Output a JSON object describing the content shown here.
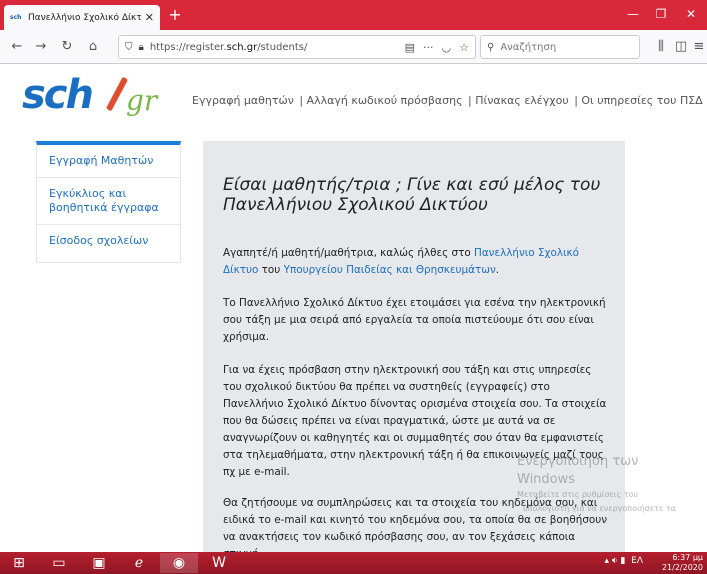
{
  "browser": {
    "tab_title": "Πανελλήνιο Σχολικό Δίκτυο - Ε",
    "favicon_text": "sch",
    "url_prefix": "https://register.",
    "url_domain": "sch.gr",
    "url_path": "/students/",
    "search_placeholder": "Αναζήτηση"
  },
  "site": {
    "logo_main": "sch",
    "logo_tld": "gr",
    "nav": [
      "Εγγραφή μαθητών",
      "| Αλλαγή κωδικού πρόσβασης",
      "| Πίνακας ελέγχου",
      "| Οι υπηρεσίες του ΠΣΔ"
    ]
  },
  "sidebar": {
    "items": [
      {
        "label": "Εγγραφή Μαθητών"
      },
      {
        "label": "Εγκύκλιος και βοηθητικά έγγραφα"
      },
      {
        "label": "Είσοδος σχολείων"
      }
    ]
  },
  "content": {
    "heading": "Είσαι μαθητής/τρια ; Γίνε και εσύ μέλος του Πανελλήνιου Σχολικού Δικτύου",
    "p1_a": "Αγαπητέ/ή μαθητή/μαθήτρια, καλώς ήλθες στο ",
    "p1_link1": "Πανελλήνιο Σχολικό Δίκτυο",
    "p1_b": " του ",
    "p1_link2": "Υπουργείου Παιδείας και Θρησκευμάτων",
    "p1_c": ".",
    "p2": "Το Πανελλήνιο Σχολικό Δίκτυο έχει ετοιμάσει για εσένα την ηλεκτρονική σου τάξη με μια σειρά από εργαλεία τα οποία πιστεύουμε ότι σου είναι χρήσιμα.",
    "p3": "Για να έχεις πρόσβαση στην ηλεκτρονική σου τάξη και στις υπηρεσίες του σχολικού δικτύου θα πρέπει να συστηθείς (εγγραφείς) στο Πανελλήνιο Σχολικό Δίκτυο δίνοντας ορισμένα στοιχεία σου. Τα στοιχεία που θα δώσεις πρέπει να είναι πραγματικά, ώστε με αυτά να σε αναγνωρίζουν οι καθηγητές και οι συμμαθητές σου όταν θα εμφανιστείς στα τηλεμαθήματα, στην ηλεκτρονική τάξη ή θα επικοινωνείς μαζί τους πχ με e-mail.",
    "p4": "Θα ζητήσουμε να συμπληρώσεις και τα στοιχεία του κηδεμόνα σου, και ειδικά το e-mail και κινητό του κηδεμόνα σου, τα οποία θα σε βοηθήσουν να ανακτήσεις τον κωδικό πρόσβασης σου, αν τον ξεχάσεις κάποια στιγμή."
  },
  "watermark": {
    "line1": "Ενεργοποίηση των",
    "line2": "Windows",
    "line3": "Μεταβείτε στις ρυθμίσεις του",
    "line4": "υπολογιστή για να ενεργοποιήσετε τα"
  },
  "taskbar": {
    "lang": "ΕΛ",
    "time": "6:37 μμ",
    "date": "21/2/2020"
  },
  "colors": {
    "browser_frame": "#d9283a",
    "brand_blue": "#1b6fc2",
    "brand_green": "#7ab648",
    "card_bg": "#e6e8eb"
  }
}
